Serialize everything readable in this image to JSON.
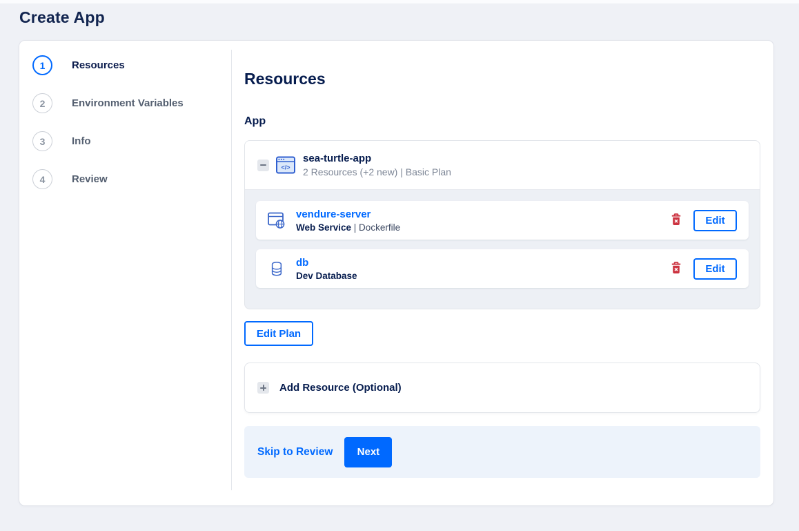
{
  "page": {
    "title": "Create App"
  },
  "steps": [
    {
      "number": "1",
      "label": "Resources"
    },
    {
      "number": "2",
      "label": "Environment Variables"
    },
    {
      "number": "3",
      "label": "Info"
    },
    {
      "number": "4",
      "label": "Review"
    }
  ],
  "main": {
    "heading": "Resources",
    "section_label": "App",
    "app": {
      "name": "sea-turtle-app",
      "summary": "2 Resources (+2 new) | Basic Plan",
      "icon": "app-window-code-icon",
      "collapse_icon": "minus-icon",
      "resources": [
        {
          "name": "vendure-server",
          "type_bold": "Web Service",
          "type_rest": " | Dockerfile",
          "icon": "web-service-globe-icon",
          "delete_icon": "trash-icon",
          "edit_label": "Edit"
        },
        {
          "name": "db",
          "type_bold": "Dev Database",
          "type_rest": "",
          "icon": "database-icon",
          "delete_icon": "trash-icon",
          "edit_label": "Edit"
        }
      ]
    },
    "edit_plan_label": "Edit Plan",
    "add_resource": {
      "label": "Add Resource (Optional)",
      "icon": "plus-icon"
    },
    "footer": {
      "skip_label": "Skip to Review",
      "next_label": "Next"
    }
  },
  "colors": {
    "accent": "#0069ff",
    "navy": "#061c4e",
    "muted_text": "#7d8696",
    "danger": "#cc3340",
    "page_bg": "#eff1f6",
    "group_body_bg": "#edf0f5",
    "footer_bg": "#edf3fb"
  }
}
